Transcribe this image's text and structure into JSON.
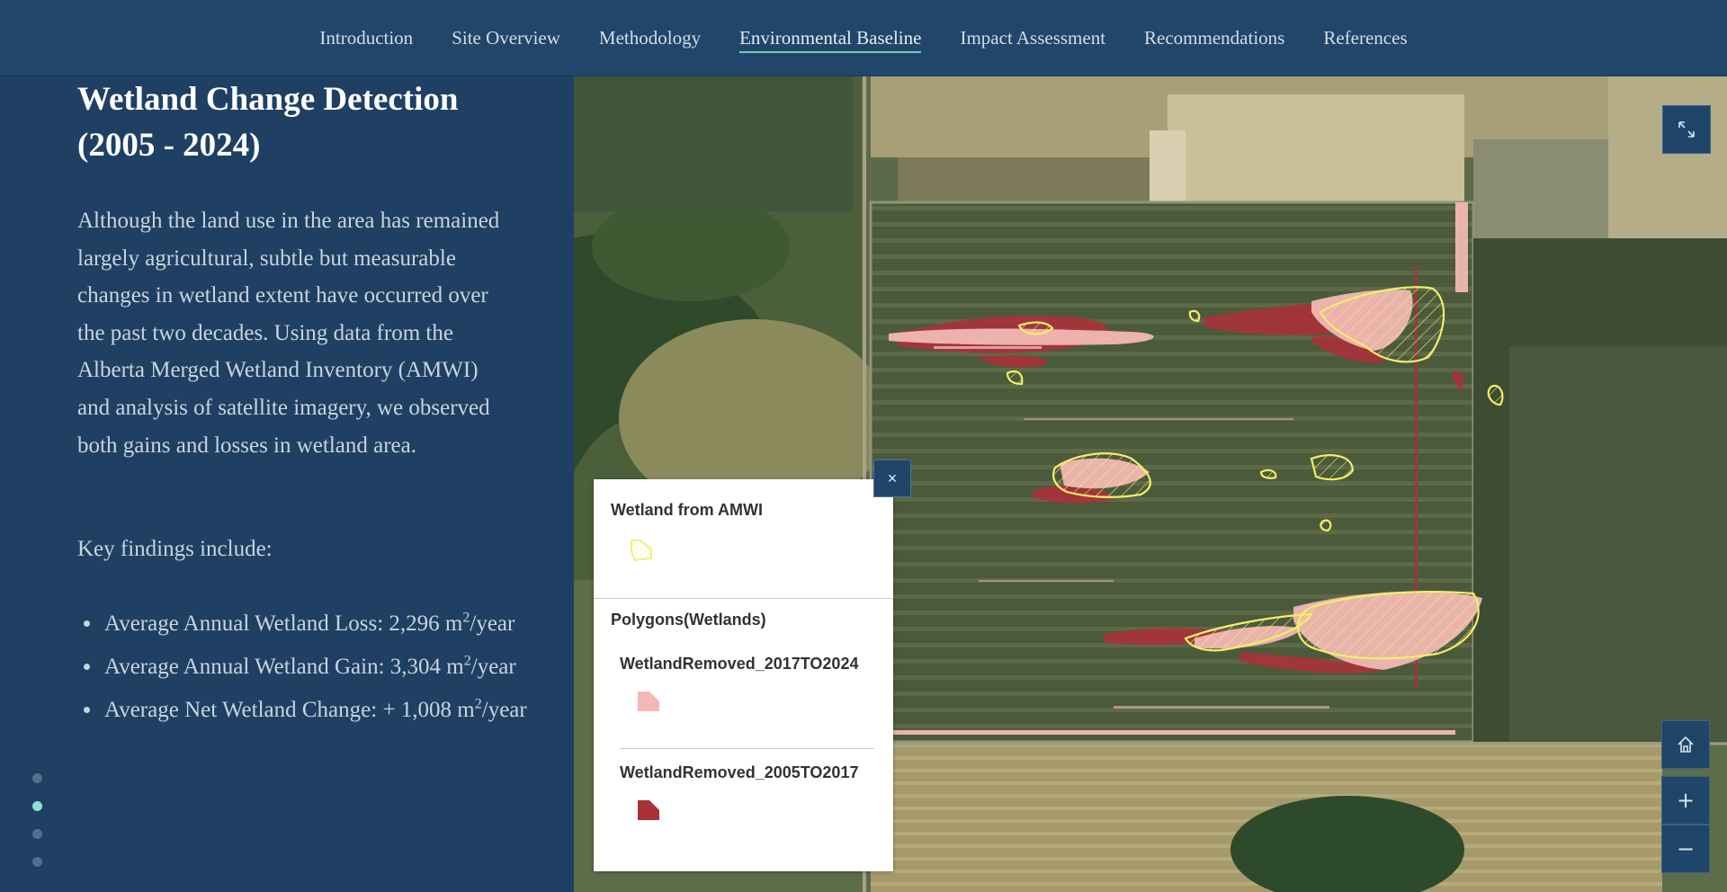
{
  "nav": {
    "items": [
      {
        "label": "Introduction"
      },
      {
        "label": "Site Overview"
      },
      {
        "label": "Methodology"
      },
      {
        "label": "Environmental Baseline",
        "active": true
      },
      {
        "label": "Impact Assessment"
      },
      {
        "label": "Recommendations"
      },
      {
        "label": "References"
      }
    ]
  },
  "narrative": {
    "title": "Wetland Change Detection (2005 - 2024)",
    "body": "Although the land use in the area has remained largely agricultural, subtle but measurable changes in wetland extent have occurred over the past two decades. Using data from the Alberta Merged Wetland Inventory (AMWI) and analysis of satellite imagery, we observed both gains and losses in wetland area.",
    "key_heading": "Key findings include:",
    "findings": [
      {
        "text": "Average Annual Wetland Loss: 2,296 m",
        "sup": "2",
        "suffix": "/year"
      },
      {
        "text": "Average Annual Wetland Gain: 3,304 m",
        "sup": "2",
        "suffix": "/year"
      },
      {
        "text": "Average Net Wetland Change: + 1,008 m",
        "sup": "2",
        "suffix": "/year"
      }
    ],
    "progress": {
      "total": 4,
      "active_index": 1
    }
  },
  "legend": {
    "close_label": "×",
    "layer1_title": "Wetland from AMWI",
    "layer2_title": "Polygons(Wetlands)",
    "entry1_label": "WetlandRemoved_2017TO2024",
    "entry2_label": "WetlandRemoved_2005TO2017",
    "colors": {
      "amwi_outline": "#f2ee6a",
      "removed_2017_2024": "#f2b8b4",
      "removed_2005_2017": "#a8323a"
    }
  },
  "map_controls": {
    "fullscreen_icon": "expand-icon",
    "home_icon": "home-icon",
    "zoom_in_label": "+",
    "zoom_out_label": "−"
  }
}
